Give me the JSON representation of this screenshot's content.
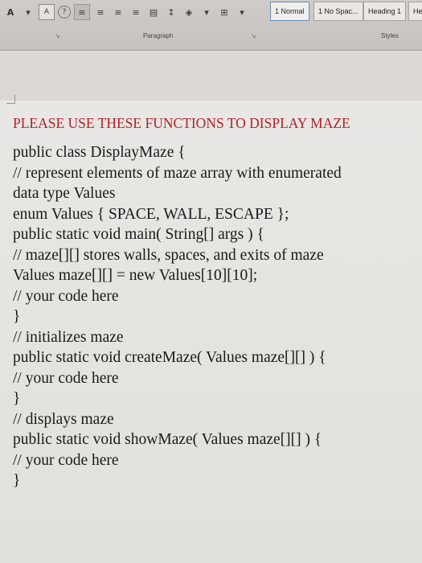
{
  "ribbon": {
    "font_color_icon": "A",
    "paragraph_label": "Paragraph",
    "styles_label": "Styles",
    "styles": [
      {
        "label": "1 Normal"
      },
      {
        "label": "1 No Spac..."
      },
      {
        "label": "Heading 1"
      },
      {
        "label": "He"
      }
    ]
  },
  "document": {
    "heading": "PLEASE USE THESE FUNCTIONS TO DISPLAY MAZE",
    "heading_color": "#b0202a",
    "lines": [
      "public class DisplayMaze {",
      "// represent elements of maze array with enumerated",
      "data type Values",
      "enum Values { SPACE, WALL, ESCAPE };",
      "public static void main( String[] args ) {",
      "// maze[][] stores walls, spaces, and exits of maze",
      "Values maze[][] = new Values[10][10];",
      "// your code here",
      "}",
      "// initializes maze",
      "public static void createMaze( Values maze[][] ) {",
      "// your code here",
      "}",
      "// displays maze",
      "public static void showMaze( Values maze[][] ) {",
      "// your code here",
      "}"
    ]
  }
}
